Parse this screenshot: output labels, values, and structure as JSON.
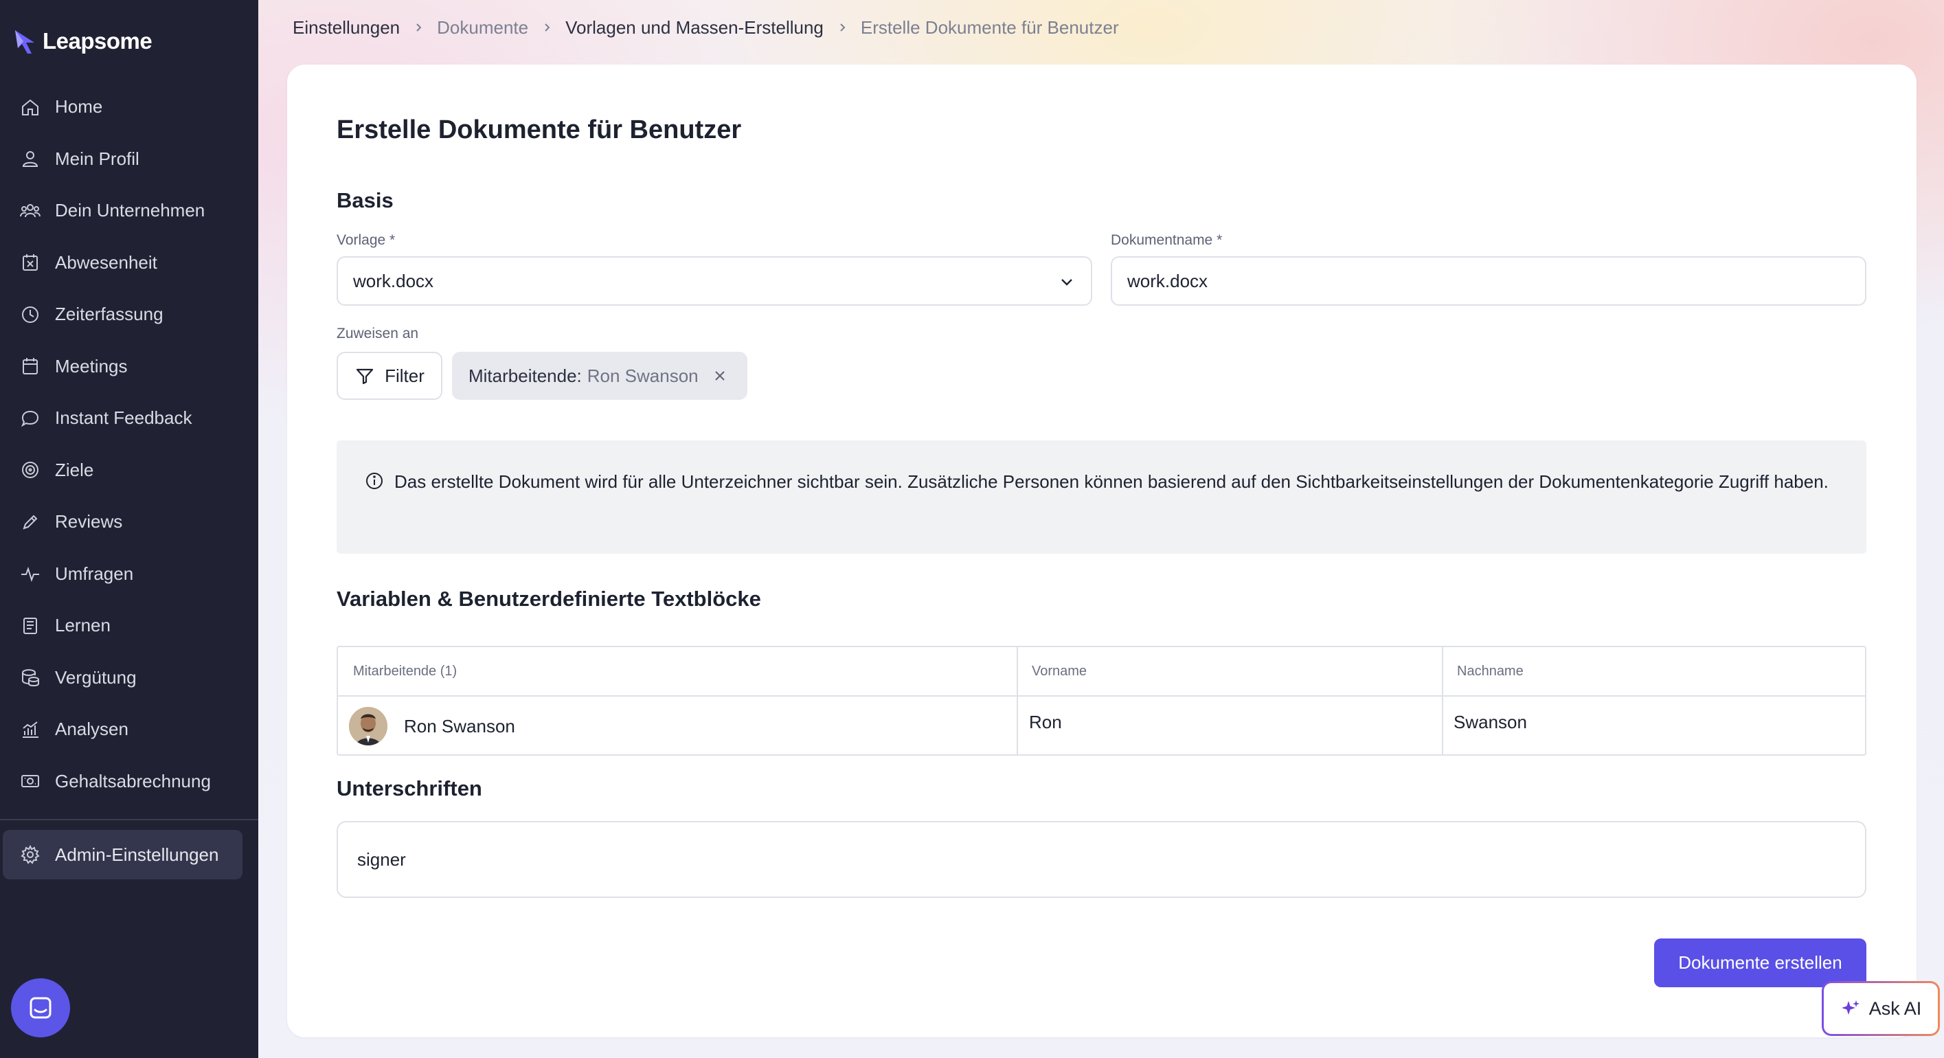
{
  "app": {
    "name": "Leapsome"
  },
  "sidebar": {
    "items": [
      {
        "label": "Home",
        "icon": "home-icon"
      },
      {
        "label": "Mein Profil",
        "icon": "user-icon"
      },
      {
        "label": "Dein Unternehmen",
        "icon": "users-icon"
      },
      {
        "label": "Abwesenheit",
        "icon": "calendar-x-icon"
      },
      {
        "label": "Zeiterfassung",
        "icon": "clock-icon"
      },
      {
        "label": "Meetings",
        "icon": "calendar-icon"
      },
      {
        "label": "Instant Feedback",
        "icon": "chat-icon"
      },
      {
        "label": "Ziele",
        "icon": "target-icon"
      },
      {
        "label": "Reviews",
        "icon": "pencil-icon"
      },
      {
        "label": "Umfragen",
        "icon": "pulse-icon"
      },
      {
        "label": "Lernen",
        "icon": "book-icon"
      },
      {
        "label": "Vergütung",
        "icon": "coins-icon"
      },
      {
        "label": "Analysen",
        "icon": "analytics-icon"
      },
      {
        "label": "Gehaltsabrechnung",
        "icon": "payroll-icon"
      }
    ],
    "admin": {
      "label": "Admin-Einstellungen",
      "icon": "gear-icon"
    }
  },
  "breadcrumb": {
    "items": [
      "Einstellungen",
      "Dokumente",
      "Vorlagen und Massen-Erstellung",
      "Erstelle Dokumente für Benutzer"
    ]
  },
  "page": {
    "title": "Erstelle Dokumente für Benutzer",
    "basis_title": "Basis",
    "template_label": "Vorlage *",
    "template_value": "work.docx",
    "docname_label": "Dokumentname *",
    "docname_value": "work.docx",
    "assign_label": "Zuweisen an",
    "filter_label": "Filter",
    "chip_key": "Mitarbeitende:",
    "chip_value": "Ron Swanson",
    "info_text": "Das erstellte Dokument wird für alle Unterzeichner sichtbar sein. Zusätzliche Personen können basierend auf den Sichtbarkeitseinstellungen der Dokumentenkategorie Zugriff haben.",
    "variables_title": "Variablen & Benutzerdefinierte Textblöcke",
    "table": {
      "headers": [
        "Mitarbeitende (1)",
        "Vorname",
        "Nachname"
      ],
      "rows": [
        {
          "name": "Ron Swanson",
          "first": "Ron",
          "last": "Swanson"
        }
      ]
    },
    "signatures_title": "Unterschriften",
    "signer": "signer",
    "submit_label": "Dokumente erstellen"
  },
  "ask_ai": {
    "label": "Ask AI"
  },
  "colors": {
    "sidebar": "#202233",
    "primary": "#5a4fe6",
    "accent_chat": "#5b56e8"
  }
}
